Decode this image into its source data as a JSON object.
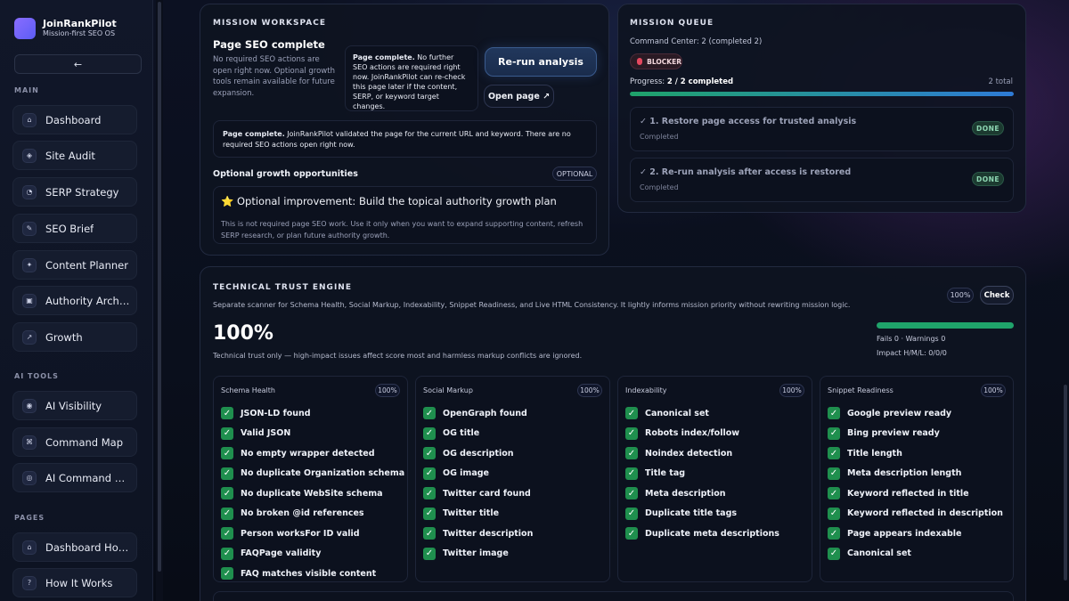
{
  "brand": {
    "name": "JoinRankPilot",
    "tagline": "Mission-first SEO OS",
    "collapse_label": "←"
  },
  "sidebar": {
    "sections": [
      {
        "label": "MAIN",
        "items": [
          {
            "label": "Dashboard",
            "icon": "⌂"
          },
          {
            "label": "Site Audit",
            "icon": "◈"
          },
          {
            "label": "SERP Strategy",
            "icon": "◔"
          },
          {
            "label": "SEO Brief",
            "icon": "✎"
          },
          {
            "label": "Content Planner",
            "icon": "✦"
          },
          {
            "label": "Authority Architect",
            "icon": "▣"
          },
          {
            "label": "Growth",
            "icon": "↗"
          }
        ]
      },
      {
        "label": "AI TOOLS",
        "items": [
          {
            "label": "AI Visibility",
            "icon": "◉"
          },
          {
            "label": "Command Map",
            "icon": "⌘"
          },
          {
            "label": "AI Command Ce...",
            "icon": "◎"
          }
        ]
      },
      {
        "label": "PAGES",
        "items": [
          {
            "label": "Dashboard Home",
            "icon": "⌂"
          },
          {
            "label": "How It Works",
            "icon": "?"
          }
        ]
      }
    ]
  },
  "mission": {
    "section_title": "MISSION WORKSPACE",
    "heading": "Page SEO complete",
    "description": "No required SEO actions are open right now. Optional growth tools remain available for future expansion.",
    "note_bold": "Page complete.",
    "note_text": " No further SEO actions are required right now. JoinRankPilot can re-check this page later if the content, SERP, or keyword target changes.",
    "rerun_label": "Re-run analysis",
    "open_label": "Open page ↗",
    "validated_bold": "Page complete.",
    "validated_text": " JoinRankPilot validated the page for the current URL and keyword. There are no required SEO actions open right now.",
    "optional_title": "Optional growth opportunities",
    "optional_badge": "OPTIONAL",
    "improvement_icon": "⭐",
    "improvement_title": "Optional improvement: Build the topical authority growth plan",
    "improvement_desc": "This is not required page SEO work. Use it only when you want to expand supporting content, refresh SERP research, or plan future authority growth."
  },
  "queue": {
    "section_title": "MISSION QUEUE",
    "command_center": "Command Center: 2 (completed 2)",
    "blocker_label": "BLOCKER",
    "progress_prefix": "Progress: ",
    "progress_value": "2 / 2 completed",
    "total": "2 total",
    "progress_fraction": 1.0,
    "progress_color": "#2e7bd6",
    "tasks": [
      {
        "title": "✓ 1. Restore page access for trusted analysis",
        "status": "Completed",
        "badge": "DONE"
      },
      {
        "title": "✓ 2. Re-run analysis after access is restored",
        "status": "Completed",
        "badge": "DONE"
      }
    ]
  },
  "trust": {
    "section_title": "TECHNICAL TRUST ENGINE",
    "description": "Separate scanner for Schema Health, Social Markup, Indexability, Snippet Readiness, and Live HTML Consistency. It lightly informs mission priority without rewriting mission logic.",
    "score_pill": "100%",
    "check_label": "Check",
    "score": "100%",
    "score_caption": "Technical trust only — high-impact issues affect score most and harmless markup conflicts are ignored.",
    "bar_fraction": 1.0,
    "bar_color": "#1fa36a",
    "fails_warnings": "Fails 0 · Warnings 0",
    "impact": "Impact H/M/L: 0/0/0",
    "columns": [
      {
        "title": "Schema Health",
        "pct": "100%",
        "items": [
          "JSON-LD found",
          "Valid JSON",
          "No empty wrapper detected",
          "No duplicate Organization schema",
          "No duplicate WebSite schema",
          "No broken @id references",
          "Person worksFor ID valid",
          "FAQPage validity",
          "FAQ matches visible content"
        ]
      },
      {
        "title": "Social Markup",
        "pct": "100%",
        "items": [
          "OpenGraph found",
          "OG title",
          "OG description",
          "OG image",
          "Twitter card found",
          "Twitter title",
          "Twitter description",
          "Twitter image"
        ]
      },
      {
        "title": "Indexability",
        "pct": "100%",
        "items": [
          "Canonical set",
          "Robots index/follow",
          "Noindex detection",
          "Title tag",
          "Meta description",
          "Duplicate title tags",
          "Duplicate meta descriptions"
        ]
      },
      {
        "title": "Snippet Readiness",
        "pct": "100%",
        "items": [
          "Google preview ready",
          "Bing preview ready",
          "Title length",
          "Meta description length",
          "Keyword reflected in title",
          "Keyword reflected in description",
          "Page appears indexable",
          "Canonical set"
        ]
      }
    ],
    "check_mark": "✓"
  }
}
